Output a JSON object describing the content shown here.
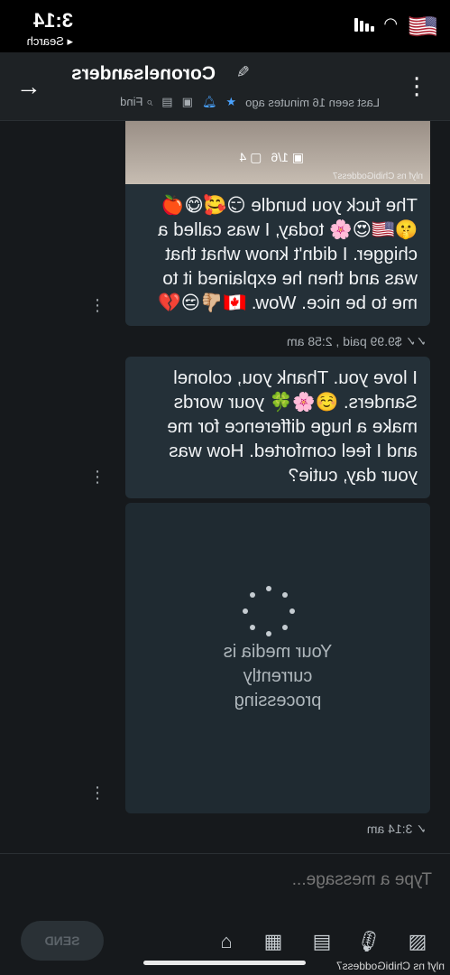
{
  "status_bar": {
    "time": "3:14",
    "back_label": "◂ Search"
  },
  "header": {
    "contact_name": "Coronelsanders",
    "last_seen": "Last seen 16 minutes ago",
    "find_label": "Find"
  },
  "messages": [
    {
      "photo_counter": "1/6",
      "photo_count_videos": "4",
      "watermark": "nlyf  ns ChibiGoddess7",
      "text": "The fuck you bundle 😏🥰😋🍎 🤫🇺🇸😍🌸 today, I was called a chigger. I didn't know what that was and then he explained it to me to be nice. Wow. 🇨🇦👎🏼😒💔",
      "meta": "$9.99 paid , 2:58 am"
    },
    {
      "text": "I love you. Thank you, colonel Sanders. ☺️🌸🍀 your words make a huge difference for me and I feel comforted. How was your day, cutie?"
    },
    {
      "processing_text": "Your media is currently processing",
      "meta": "3:14 am"
    }
  ],
  "composer": {
    "placeholder": "Type a message...",
    "send_label": "SEND"
  },
  "bottom_watermark": "nlyf  ns ChibiGoddess7",
  "colors": {
    "background": "#16191c",
    "bubble": "#243038",
    "accent": "#4aa3ff"
  }
}
